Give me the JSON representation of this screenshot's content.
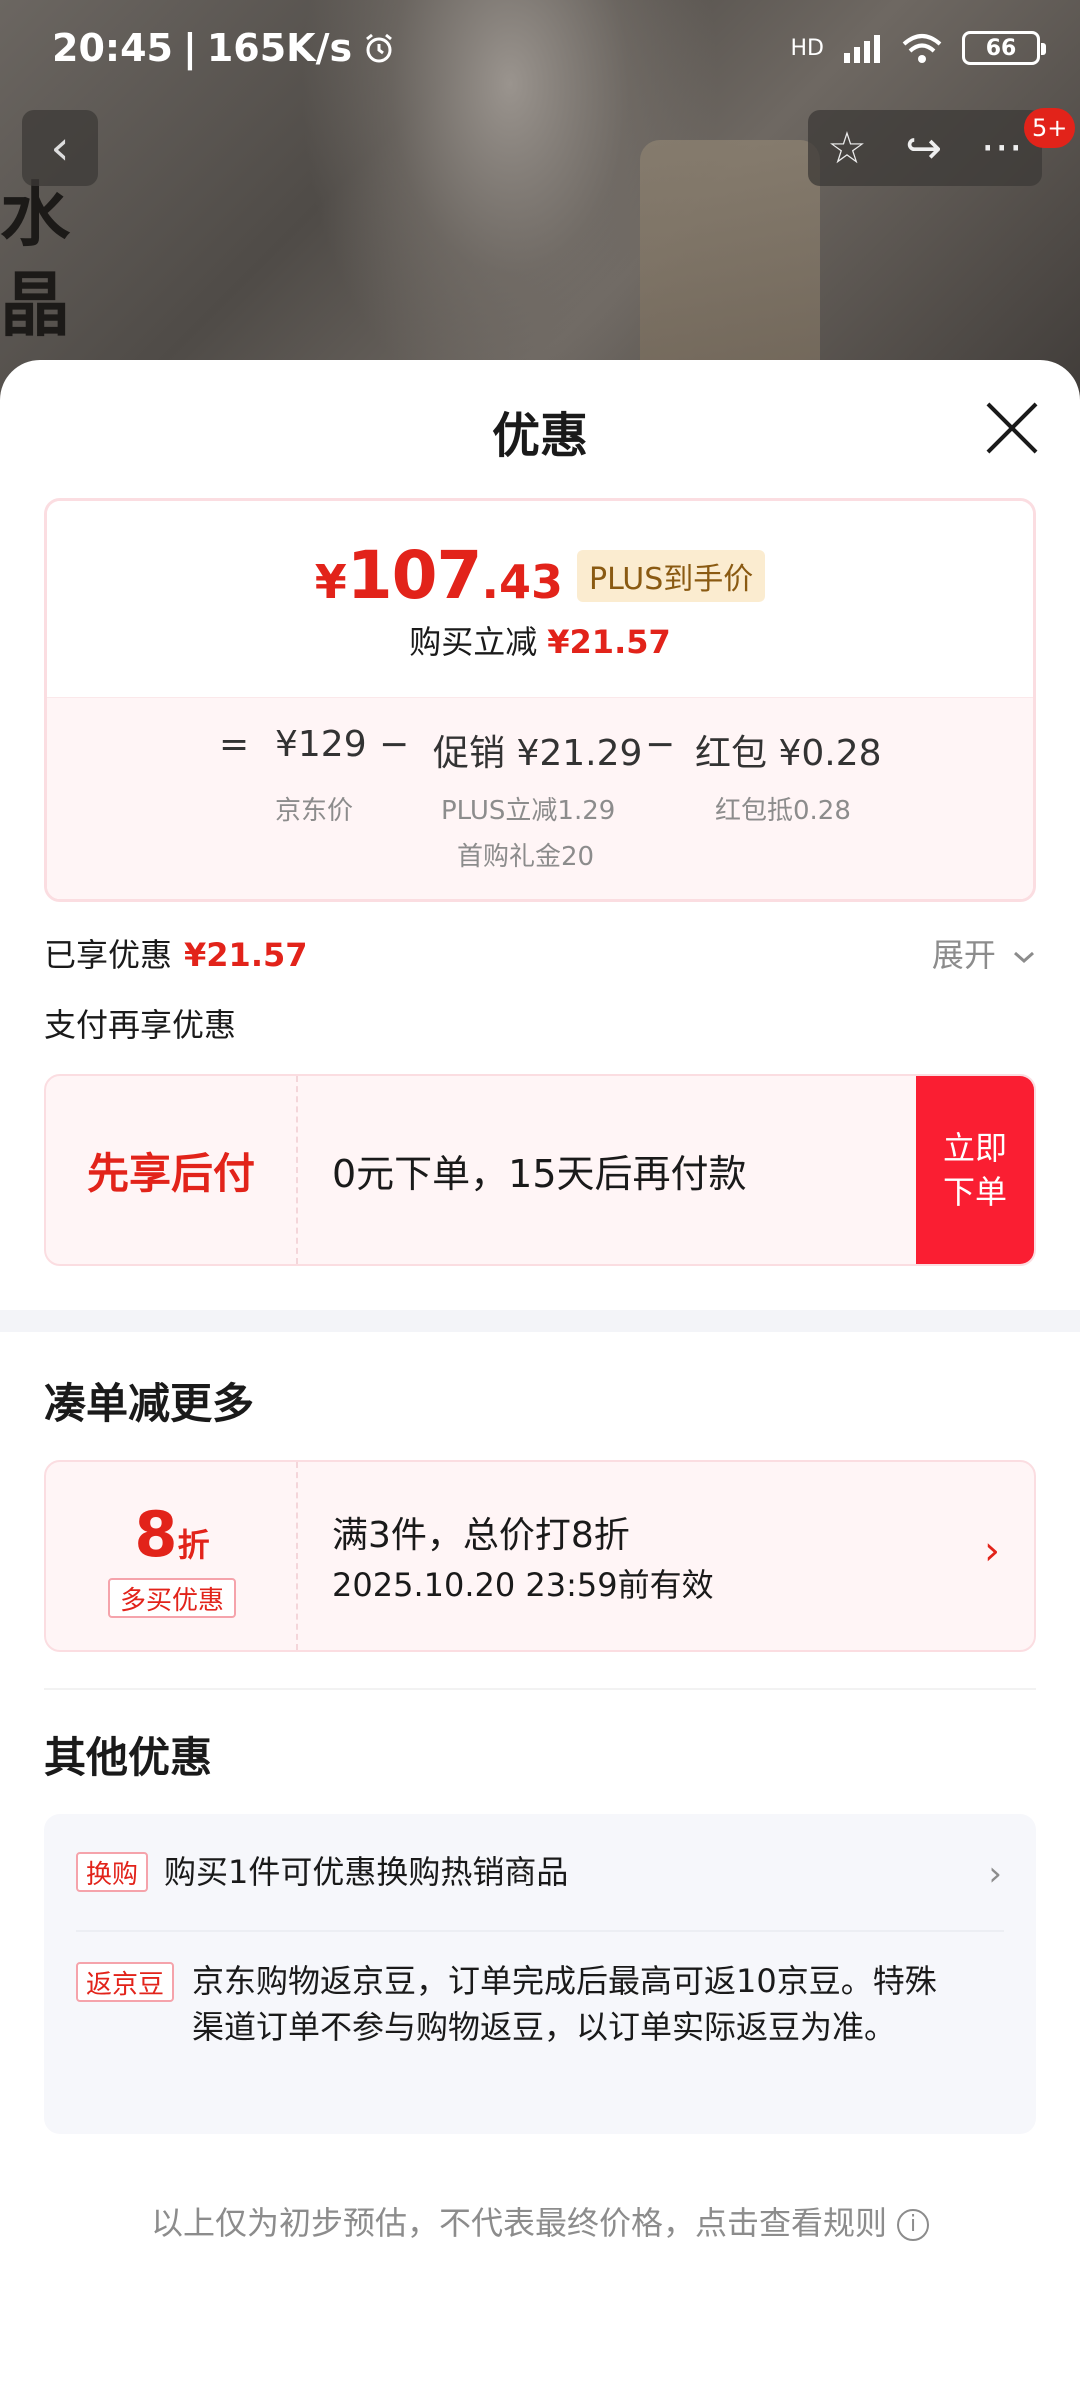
{
  "status_bar": {
    "time": "20:45",
    "speed": "165K/s",
    "alarm_icon": "alarm-clock-icon",
    "network": "HD",
    "battery": "66"
  },
  "background": {
    "calligraphy": "水晶"
  },
  "nav": {
    "back_icon": "‹",
    "star_icon": "☆",
    "share_icon": "↪",
    "more_icon": "···",
    "badge": "5+"
  },
  "sheet": {
    "title": "优惠",
    "price_card": {
      "currency": "¥",
      "price_int": "107",
      "price_dec": ".43",
      "plus_tag": "PLUS到手价",
      "buy_reduce_label": "购买立减",
      "buy_reduce_value": "¥21.57",
      "formula": {
        "equals": "=",
        "jd_price": "¥129",
        "minus1": "−",
        "promo": "促销 ¥21.29",
        "minus2": "−",
        "redpacket": "红包 ¥0.28"
      },
      "sub": {
        "jd_price_label": "京东价",
        "plus_reduce": "PLUS立减1.29",
        "first_gift": "首购礼金20",
        "redpacket_deduct": "红包抵0.28"
      }
    },
    "enjoyed": {
      "label": "已享优惠",
      "value": "¥21.57",
      "expand": "展开"
    },
    "pay_more": "支付再享优惠",
    "bnpl": {
      "title": "先享后付",
      "desc": "0元下单，15天后再付款",
      "button": "立即下单"
    },
    "bundle": {
      "section_title": "凑单减更多",
      "discount_big": "8",
      "discount_small": "折",
      "tag": "多买优惠",
      "line1": "满3件，总价打8折",
      "line2": "2025.10.20 23:59前有效"
    },
    "other": {
      "section_title": "其他优惠",
      "items": [
        {
          "tag": "换购",
          "text": "购买1件可优惠换购热销商品"
        },
        {
          "tag": "返京豆",
          "text": "京东购物返京豆，订单完成后最高可返10京豆。特殊渠道订单不参与购物返豆，以订单实际返豆为准。"
        }
      ]
    },
    "footnote": "以上仅为初步预估，不代表最终价格，点击查看规则"
  },
  "colors": {
    "brand_red": "#e2231a",
    "button_red": "#fa1e32",
    "plus_tag_bg": "#fbecd0"
  }
}
